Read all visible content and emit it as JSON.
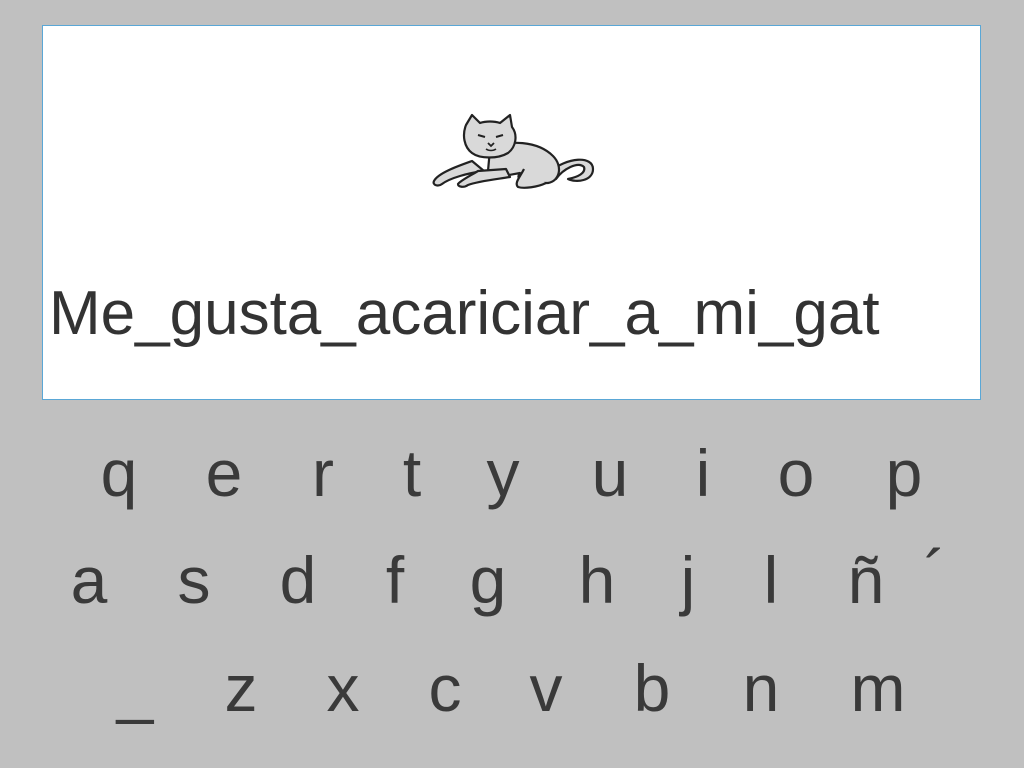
{
  "display": {
    "sentence": "Me_gusta_acariciar_a_mi_gat",
    "picture_icon": "cat-icon"
  },
  "keyboard": {
    "row1": [
      "q",
      "e",
      "r",
      "t",
      "y",
      "u",
      "i",
      "o",
      "p"
    ],
    "row2": [
      "a",
      "s",
      "d",
      "f",
      "g",
      "h",
      "j",
      "l",
      "ñ",
      "´"
    ],
    "row3": [
      "_",
      "z",
      "x",
      "c",
      "v",
      "b",
      "n",
      "m"
    ]
  },
  "colors": {
    "background": "#c0c0c0",
    "panel": "#ffffff",
    "panel_border": "#5aa7d6",
    "text": "#333333"
  }
}
